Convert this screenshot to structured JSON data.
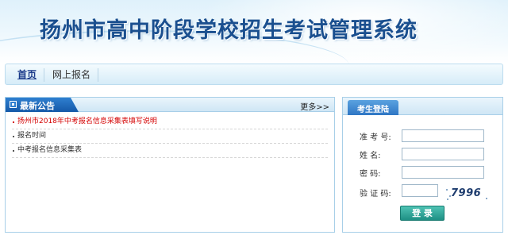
{
  "header": {
    "title": "扬州市高中阶段学校招生考试管理系统"
  },
  "nav": {
    "items": [
      "首页",
      "网上报名"
    ]
  },
  "news": {
    "title": "最新公告",
    "more_label": "更多>>",
    "items": [
      "扬州市2018年中考报名信息采集表填写说明",
      "报名时间",
      "中考报名信息采集表"
    ]
  },
  "login": {
    "title": "考生登陆",
    "exam_no_label": "准 考 号:",
    "name_label": "姓    名:",
    "password_label": "密    码:",
    "captcha_label": "验 证 码:",
    "captcha_text": "7996",
    "submit_label": "登 录"
  },
  "colors": {
    "title_blue": "#1a4f8f",
    "accent_blue": "#2f7fd0",
    "alert_red": "#d40000",
    "button_teal": "#1e8f84"
  }
}
